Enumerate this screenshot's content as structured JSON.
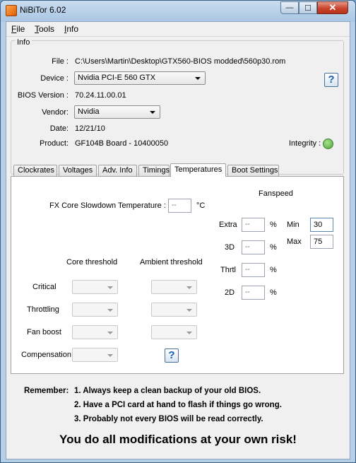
{
  "window": {
    "title": "NiBiTor 6.02",
    "controls": {
      "minimize": "—",
      "maximize": "☐",
      "close": "✕"
    }
  },
  "menu": [
    {
      "label": "File",
      "accel": "F",
      "rest": "ile"
    },
    {
      "label": "Tools",
      "accel": "T",
      "rest": "ools"
    },
    {
      "label": "Info",
      "accel": "I",
      "rest": "nfo"
    }
  ],
  "info": {
    "group_label": "Info",
    "file_label": "File :",
    "file_value": "C:\\Users\\Martin\\Desktop\\GTX560-BIOS modded\\560p30.rom",
    "device_label": "Device :",
    "device_value": "Nvidia PCI-E 560 GTX",
    "bios_version_label": "BIOS Version :",
    "bios_version_value": "70.24.11.00.01",
    "vendor_label": "Vendor:",
    "vendor_value": "Nvidia",
    "date_label": "Date:",
    "date_value": "12/21/10",
    "product_label": "Product:",
    "product_value": "GF104B Board - 10400050",
    "integrity_label": "Integrity :",
    "help_label": "?"
  },
  "tabs": [
    "Clockrates",
    "Voltages",
    "Adv. Info",
    "Timings",
    "Temperatures",
    "Boot Settings"
  ],
  "active_tab": "Temperatures",
  "temperatures": {
    "fx_slowdown_label": "FX Core Slowdown Temperature :",
    "fx_slowdown_value": "--",
    "fx_slowdown_unit": "°C",
    "core_threshold_label": "Core threshold",
    "ambient_threshold_label": "Ambient threshold",
    "rows": [
      "Critical",
      "Throttling",
      "Fan boost",
      "Compensation"
    ],
    "help_label": "?",
    "fanspeed_label": "Fanspeed",
    "fan_rows": [
      {
        "label": "Extra",
        "value": "--",
        "unit": "%"
      },
      {
        "label": "3D",
        "value": "--",
        "unit": "%"
      },
      {
        "label": "Thrtl",
        "value": "--",
        "unit": "%"
      },
      {
        "label": "2D",
        "value": "--",
        "unit": "%"
      }
    ],
    "min_label": "Min",
    "min_value": "30",
    "max_label": "Max",
    "max_value": "75"
  },
  "remember": {
    "title": "Remember:",
    "line1": "1. Always keep a clean backup of your old BIOS.",
    "line2": "2. Have a PCI card at hand to flash if things go wrong.",
    "line3": "3. Probably not every BIOS will be read correctly."
  },
  "risk_text": "You do all modifications at your own risk!",
  "colors": {
    "integrity_ok": "#4ea63a",
    "close_button": "#c8452c"
  }
}
